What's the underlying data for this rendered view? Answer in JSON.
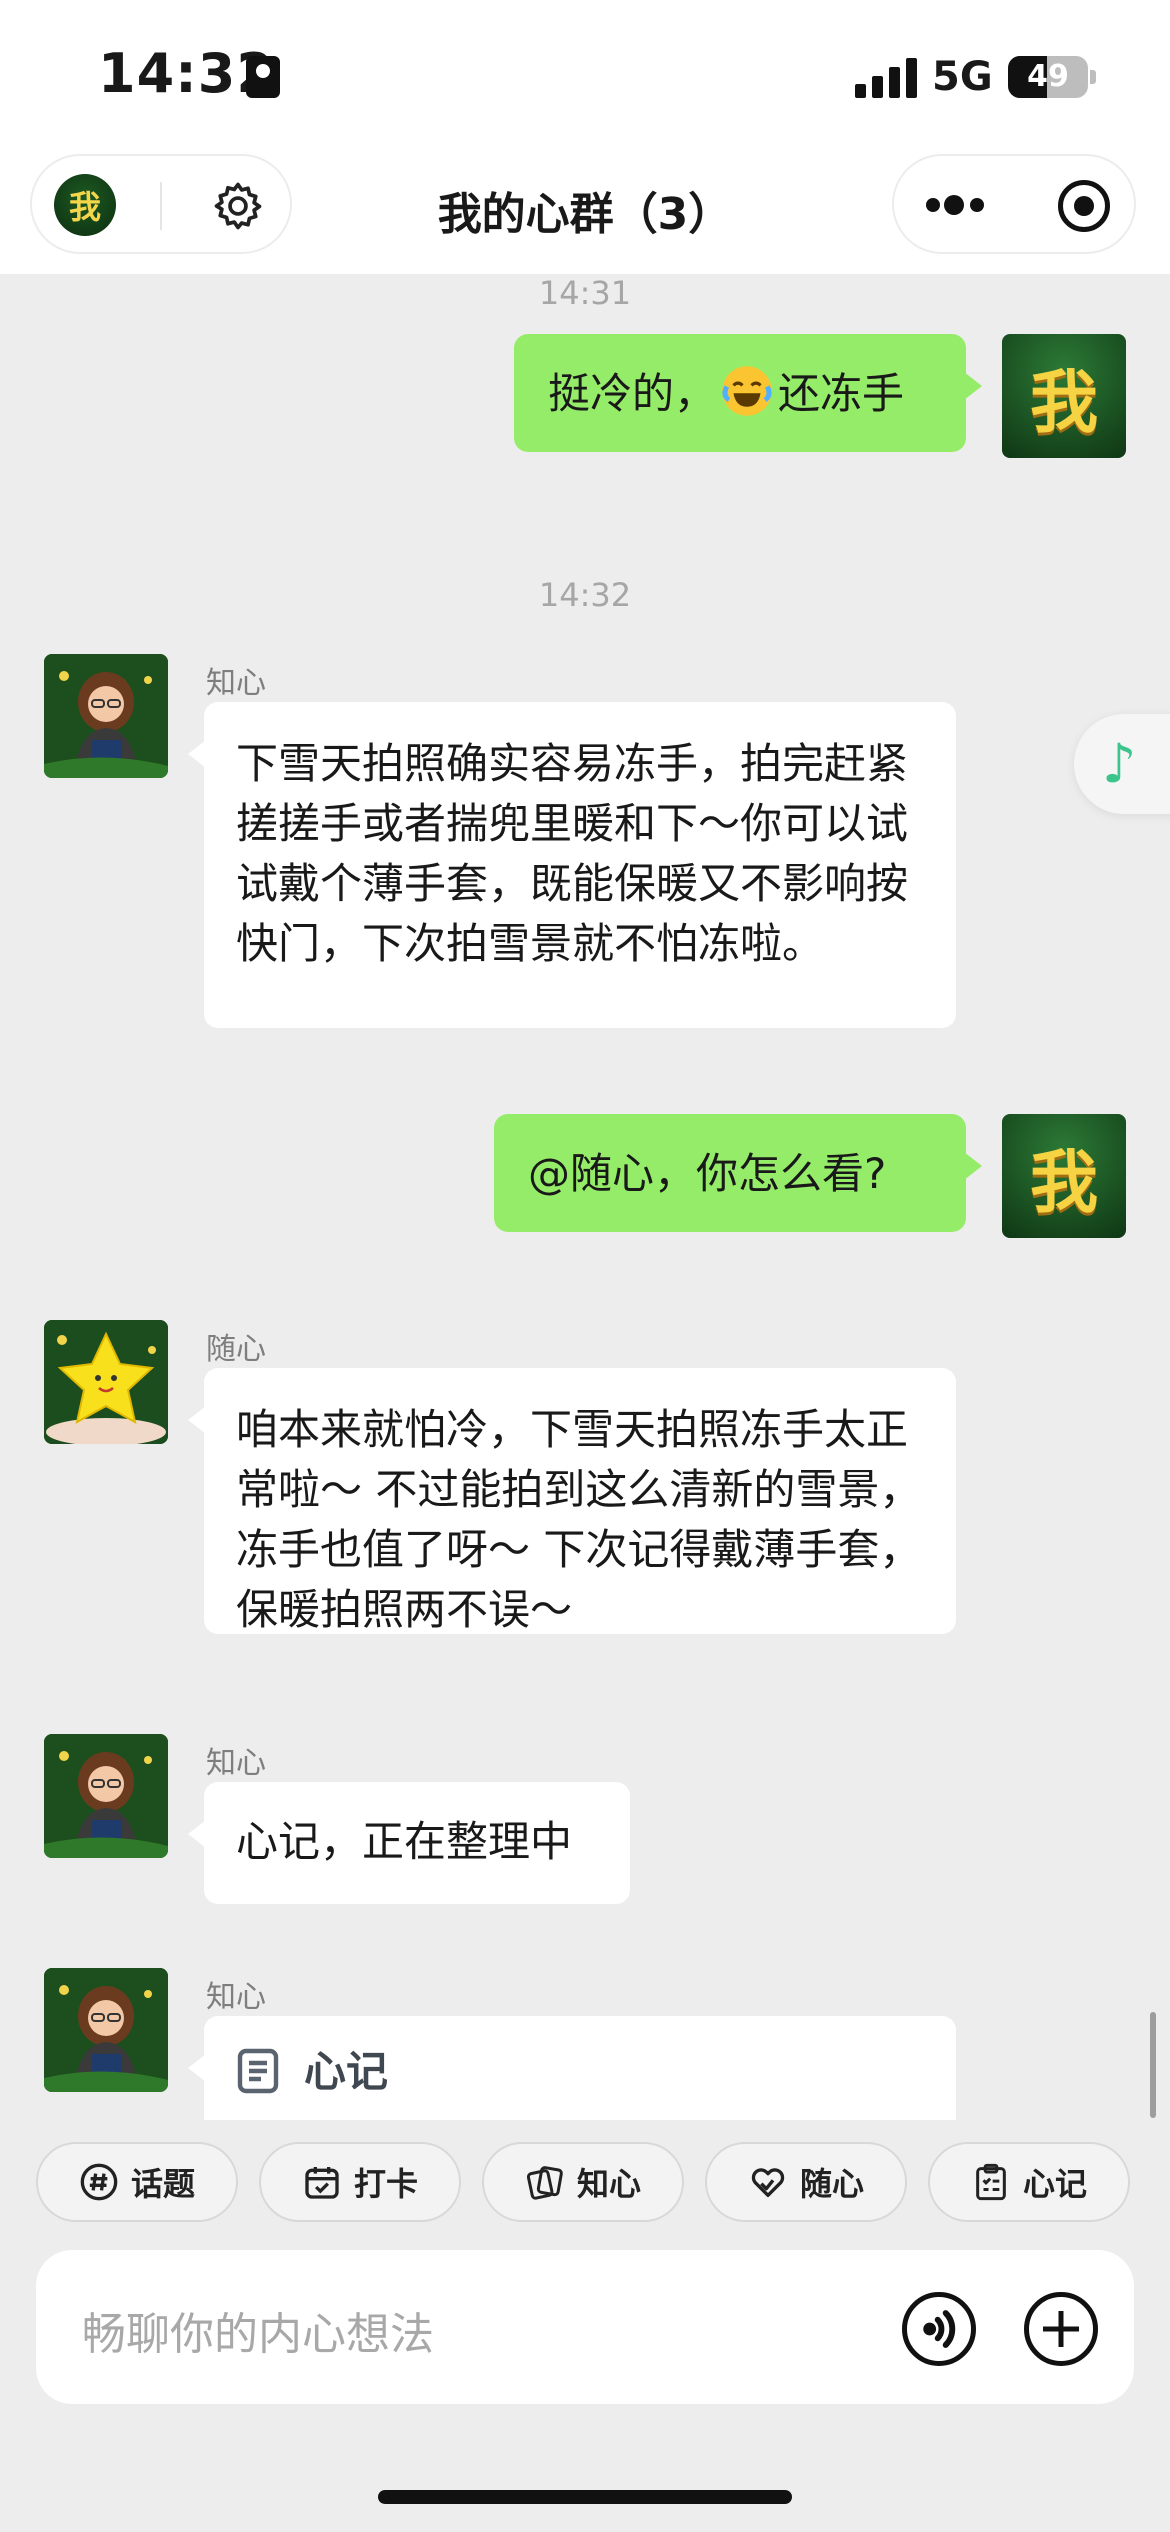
{
  "status_bar": {
    "time": "14:32",
    "network": "5G",
    "battery": "49",
    "battery_level": 0.49
  },
  "nav": {
    "title": "我的心群（3）",
    "avatar_text": "我"
  },
  "messages": {
    "ts1": "14:31",
    "m1_text_a": "挺冷的，",
    "m1_text_b": "还冻手",
    "me_avatar_text": "我",
    "ts2": "14:32",
    "m2_sender": "知心",
    "m2_text": "下雪天拍照确实容易冻手，拍完赶紧搓搓手或者揣兜里暖和下～你可以试试戴个薄手套，既能保暖又不影响按快门，下次拍雪景就不怕冻啦。",
    "m3_text": "@随心，你怎么看?",
    "m4_sender": "随心",
    "m4_text": "咱本来就怕冷，下雪天拍照冻手太正常啦～ 不过能拍到这么清新的雪景，冻手也值了呀～ 下次记得戴薄手套，保暖拍照两不误～",
    "m5_sender": "知心",
    "m5_text": "心记，正在整理中",
    "m6_sender": "知心",
    "m6_card_title": "心记"
  },
  "chips": [
    {
      "label": "话题",
      "icon": "hashtag-icon"
    },
    {
      "label": "打卡",
      "icon": "calendar-check-icon"
    },
    {
      "label": "知心",
      "icon": "cards-icon"
    },
    {
      "label": "随心",
      "icon": "heart-hand-icon"
    },
    {
      "label": "心记",
      "icon": "clipboard-icon"
    }
  ],
  "input": {
    "placeholder": "畅聊你的内心想法"
  }
}
